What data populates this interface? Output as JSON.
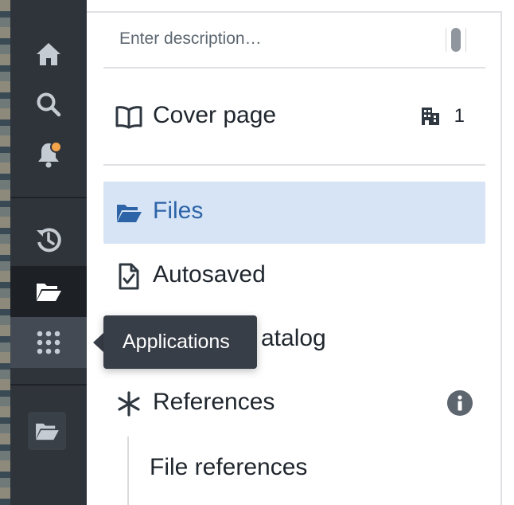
{
  "colors": {
    "rail_bg": "#2f343b",
    "rail_active": "#1d2126",
    "notification_dot": "#f5a34b",
    "selected_bg": "#d6e4f5",
    "selected_text": "#2d64a8",
    "tooltip_bg": "#383e47"
  },
  "rail": {
    "items": [
      {
        "icon": "home-icon"
      },
      {
        "icon": "search-icon"
      },
      {
        "icon": "bell-icon",
        "has_notification": true
      },
      {
        "icon": "history-icon"
      },
      {
        "icon": "folder-open-icon",
        "active": true
      },
      {
        "icon": "apps-grid-icon",
        "hovered": true
      }
    ],
    "bottom_item": {
      "icon": "folder-open-icon"
    }
  },
  "description": {
    "placeholder": "Enter description…"
  },
  "cover": {
    "label": "Cover page",
    "icon": "book-open-icon",
    "count_icon": "building-icon",
    "count": "1"
  },
  "nav": {
    "files": {
      "label": "Files",
      "icon": "folder-open-icon",
      "selected": true
    },
    "autosaved": {
      "label": "Autosaved",
      "icon": "document-check-icon"
    },
    "catalog": {
      "label_visible_tail": "atalog"
    },
    "references": {
      "label": "References",
      "icon": "asterisk-icon",
      "trailing_icon": "info-icon"
    },
    "file_references": {
      "label": "File references"
    }
  },
  "tooltip": {
    "text": "Applications"
  }
}
